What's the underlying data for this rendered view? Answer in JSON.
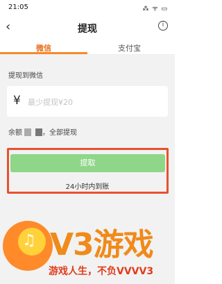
{
  "status_bar": {
    "time": "21:05",
    "icons": "⁂ ᯤ ▭"
  },
  "nav": {
    "back_icon": "‹",
    "title": "提现",
    "info_icon": "i"
  },
  "tabs": [
    {
      "label": "微信",
      "active": true
    },
    {
      "label": "支付宝",
      "active": false
    }
  ],
  "colors": {
    "accent": "#e86c1a",
    "tab_underline": "#f58a2a",
    "button": "#8fd689",
    "highlight": "#e8502e",
    "background": "#f2f2f2"
  },
  "form": {
    "withdraw_to_label": "提现到微信",
    "currency_symbol": "¥",
    "amount_placeholder": "最少提现¥20",
    "balance_label": "余额",
    "withdraw_all_label": "，全部提现"
  },
  "action": {
    "withdraw_button": "提取",
    "arrival_note": "24小时内到账"
  },
  "watermark": {
    "brand": "V3游戏",
    "slogan": "游戏人生，不负VVVV3"
  }
}
